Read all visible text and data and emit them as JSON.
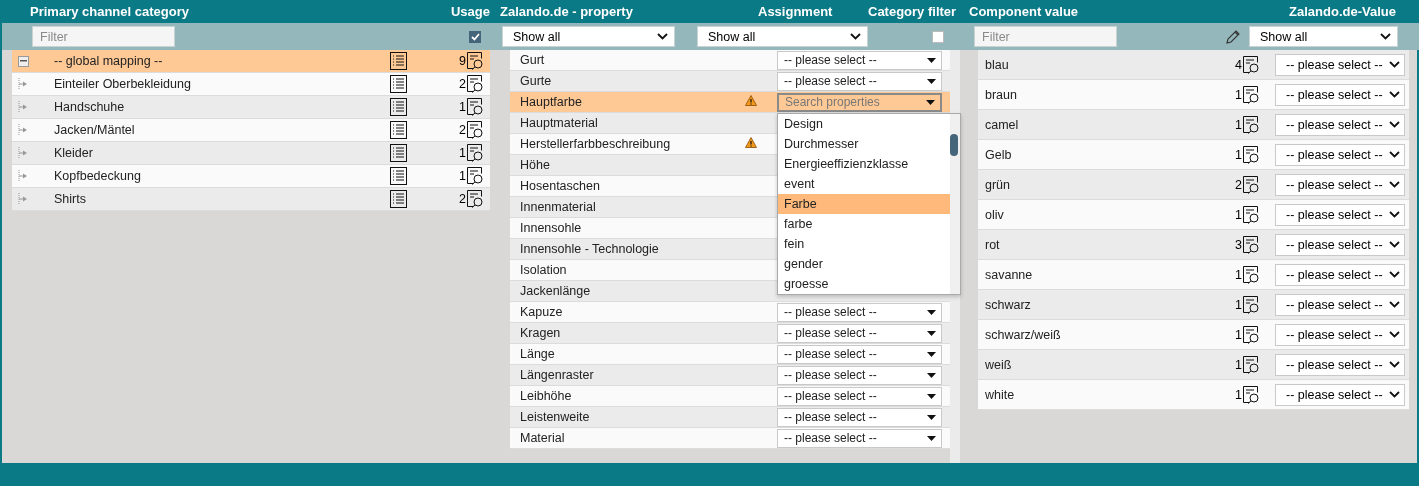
{
  "category_panel": {
    "headers": {
      "category": "Primary channel category",
      "usage": "Usage"
    },
    "filter": {
      "placeholder": "Filter"
    },
    "usage_filter_checked": true,
    "tree": [
      {
        "label": "-- global mapping --",
        "count": "9",
        "selected": true,
        "expanded": true,
        "children": [
          {
            "label": "Einteiler Oberbekleidung",
            "count": "2",
            "selected": false
          },
          {
            "label": "Handschuhe",
            "count": "1",
            "selected": false
          },
          {
            "label": "Jacken/Mäntel",
            "count": "2",
            "selected": false
          },
          {
            "label": "Kleider",
            "count": "1",
            "selected": false
          },
          {
            "label": "Kopfbedeckung",
            "count": "1",
            "selected": false
          },
          {
            "label": "Shirts",
            "count": "2",
            "selected": false
          }
        ]
      }
    ]
  },
  "property_panel": {
    "headers": {
      "property": "Zalando.de - property",
      "assignment": "Assignment",
      "category_filter": "Category filter"
    },
    "property_filter": "Show all",
    "assignment_filter": "Show all",
    "category_filter_checked": false,
    "rows": [
      {
        "label": "Gurt",
        "warning": false,
        "selected": false,
        "assignment": "-- please select --"
      },
      {
        "label": "Gurte",
        "warning": false,
        "selected": false,
        "assignment": "-- please select --"
      },
      {
        "label": "Hauptfarbe",
        "warning": true,
        "selected": true,
        "search_placeholder": "Search properties"
      },
      {
        "label": "Hauptmaterial",
        "warning": false,
        "selected": false
      },
      {
        "label": "Herstellerfarbbeschreibung",
        "warning": true,
        "selected": false
      },
      {
        "label": "Höhe",
        "warning": false,
        "selected": false
      },
      {
        "label": "Hosentaschen",
        "warning": false,
        "selected": false
      },
      {
        "label": "Innenmaterial",
        "warning": false,
        "selected": false
      },
      {
        "label": "Innensohle",
        "warning": false,
        "selected": false
      },
      {
        "label": "Innensohle - Technologie",
        "warning": false,
        "selected": false
      },
      {
        "label": "Isolation",
        "warning": false,
        "selected": false
      },
      {
        "label": "Jackenlänge",
        "warning": false,
        "selected": false
      },
      {
        "label": "Kapuze",
        "warning": false,
        "selected": false,
        "assignment": "-- please select --"
      },
      {
        "label": "Kragen",
        "warning": false,
        "selected": false,
        "assignment": "-- please select --"
      },
      {
        "label": "Länge",
        "warning": false,
        "selected": false,
        "assignment": "-- please select --"
      },
      {
        "label": "Längenraster",
        "warning": false,
        "selected": false,
        "assignment": "-- please select --"
      },
      {
        "label": "Leibhöhe",
        "warning": false,
        "selected": false,
        "assignment": "-- please select --"
      },
      {
        "label": "Leistenweite",
        "warning": false,
        "selected": false,
        "assignment": "-- please select --"
      },
      {
        "label": "Material",
        "warning": false,
        "selected": false,
        "assignment": "-- please select --"
      }
    ],
    "dropdown": {
      "items": [
        {
          "label": "Design",
          "selected": false
        },
        {
          "label": "Durchmesser",
          "selected": false
        },
        {
          "label": "Energieeffizienzklasse",
          "selected": false
        },
        {
          "label": "event",
          "selected": false
        },
        {
          "label": "Farbe",
          "selected": true
        },
        {
          "label": "farbe",
          "selected": false
        },
        {
          "label": "fein",
          "selected": false
        },
        {
          "label": "gender",
          "selected": false
        },
        {
          "label": "groesse",
          "selected": false
        }
      ]
    }
  },
  "value_panel": {
    "headers": {
      "component_value": "Component value",
      "zalando_value": "Zalando.de-Value"
    },
    "filter": {
      "placeholder": "Filter"
    },
    "value_filter": "Show all",
    "rows": [
      {
        "label": "blau",
        "count": "4",
        "assignment": "-- please select --"
      },
      {
        "label": "braun",
        "count": "1",
        "assignment": "-- please select --"
      },
      {
        "label": "camel",
        "count": "1",
        "assignment": "-- please select --"
      },
      {
        "label": "Gelb",
        "count": "1",
        "assignment": "-- please select --"
      },
      {
        "label": "grün",
        "count": "2",
        "assignment": "-- please select --"
      },
      {
        "label": "oliv",
        "count": "1",
        "assignment": "-- please select --"
      },
      {
        "label": "rot",
        "count": "3",
        "assignment": "-- please select --"
      },
      {
        "label": "savanne",
        "count": "1",
        "assignment": "-- please select --"
      },
      {
        "label": "schwarz",
        "count": "1",
        "assignment": "-- please select --"
      },
      {
        "label": "schwarz/weiß",
        "count": "1",
        "assignment": "-- please select --"
      },
      {
        "label": "weiß",
        "count": "1",
        "assignment": "-- please select --"
      },
      {
        "label": "white",
        "count": "1",
        "assignment": "-- please select --"
      }
    ]
  }
}
